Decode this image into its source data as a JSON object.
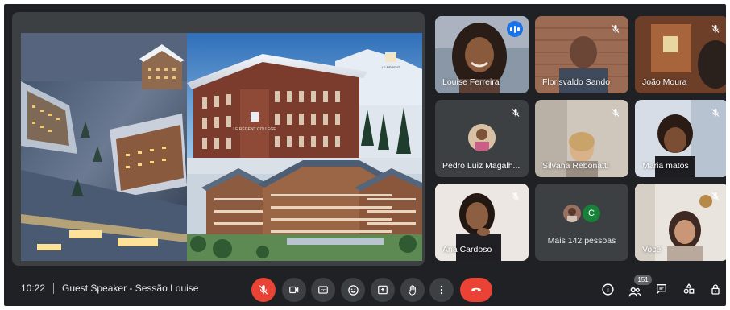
{
  "meeting": {
    "time": "10:22",
    "title": "Guest Speaker - Sessão Louise"
  },
  "presentation": {
    "building_sign": "LE RÉGENT COLLEGE",
    "logo_text": "LE RÉGENT"
  },
  "participants": [
    {
      "name": "Louise Ferreira",
      "speaking": true
    },
    {
      "name": "Florisvaldo Sando",
      "muted": true
    },
    {
      "name": "João Moura",
      "muted": true
    },
    {
      "name": "Pedro Luiz Magalh...",
      "muted": true
    },
    {
      "name": "Silvana Rebonatti",
      "muted": true
    },
    {
      "name": "Maria matos",
      "muted": true
    },
    {
      "name": "Ana Cardoso",
      "muted": true
    },
    {
      "name": "Você",
      "muted": true
    }
  ],
  "others": {
    "label": "Mais 142 pessoas",
    "avatar_letter": "C"
  },
  "toolbar": {
    "participant_count": "151"
  },
  "icons": {
    "mic_off": "mic-off-icon",
    "camera": "camera-icon",
    "captions": "closed-captions-icon",
    "emoji": "emoji-icon",
    "present": "present-screen-icon",
    "raise_hand": "raise-hand-icon",
    "more": "more-options-icon",
    "end_call": "end-call-icon",
    "info": "info-icon",
    "people": "people-icon",
    "chat": "chat-icon",
    "activities": "activities-icon",
    "host_controls": "host-controls-icon"
  },
  "colors": {
    "background": "#202124",
    "tile": "#3c4043",
    "accent": "#8ab4f8",
    "danger": "#ea4335",
    "speaking": "#1a73e8"
  }
}
